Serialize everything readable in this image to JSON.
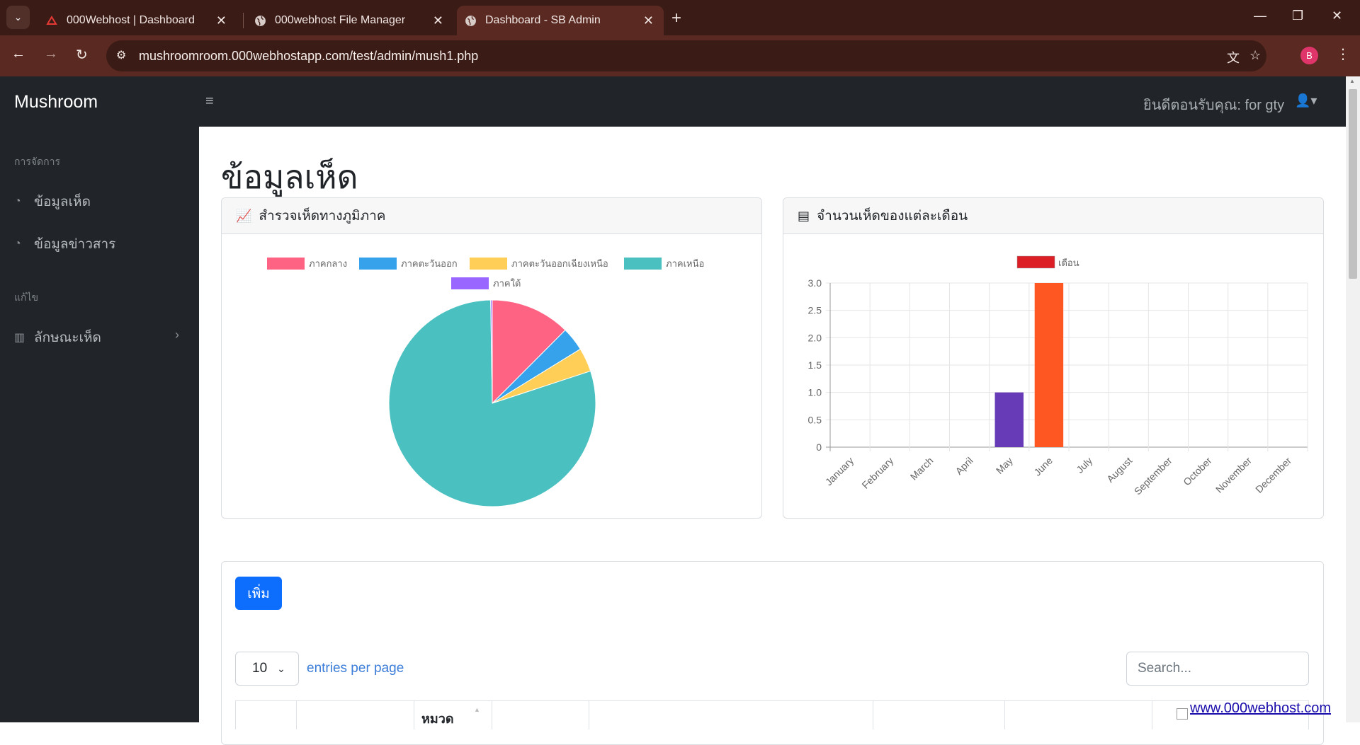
{
  "browser": {
    "tabs": [
      {
        "title": "000Webhost | Dashboard",
        "icon": "webhost-logo-icon"
      },
      {
        "title": "000webhost File Manager",
        "icon": "globe-icon"
      },
      {
        "title": "Dashboard - SB Admin",
        "icon": "globe-icon",
        "active": true
      }
    ],
    "url": "mushroomroom.000webhostapp.com/test/admin/mush1.php",
    "profile_initial": "B"
  },
  "navbar": {
    "brand": "Mushroom",
    "welcome": "ยินดีตอนรับคุณ: for gty"
  },
  "sidebar": {
    "sections": [
      {
        "heading": "การจัดการ",
        "items": [
          {
            "label": "ข้อมูลเห็ด",
            "icon": "dashboard-icon"
          },
          {
            "label": "ข้อมูลข่าวสาร",
            "icon": "dashboard-icon"
          }
        ]
      },
      {
        "heading": "แก้ไข",
        "items": [
          {
            "label": "ลักษณะเห็ด",
            "icon": "columns-icon"
          }
        ]
      }
    ]
  },
  "main": {
    "title": "ข้อมูลเห็ด",
    "pie_card_title": "สำรวจเห็ดทางภูมิภาค",
    "bar_card_title": "จำนวนเห็ดของแต่ละเดือน",
    "add_button": "เพิ่ม",
    "entries_value": "10",
    "entries_label": "entries per page",
    "search_placeholder": "Search...",
    "table_header_visible": "หมวด"
  },
  "footer_link": "www.000webhost.com",
  "chart_data": [
    {
      "type": "pie",
      "categories": [
        "ภาคกลาง",
        "ภาคตะวันออก",
        "ภาคตะวันออกเฉียงเหนือ",
        "ภาคเหนือ",
        "ภาคใต้"
      ],
      "values": [
        5,
        1.5,
        1.5,
        32,
        0.1
      ],
      "colors": [
        "#ff6384",
        "#36a2eb",
        "#ffce56",
        "#4bc0c0",
        "#9966ff"
      ],
      "legend": "top"
    },
    {
      "type": "bar",
      "categories": [
        "January",
        "February",
        "March",
        "April",
        "May",
        "June",
        "July",
        "August",
        "September",
        "October",
        "November",
        "December"
      ],
      "series": [
        {
          "name": "เดือน",
          "values": [
            0,
            0,
            0,
            0,
            1,
            3,
            0,
            0,
            0,
            0,
            0,
            0
          ]
        }
      ],
      "bar_colors": [
        "#c9cbcf",
        "#c9cbcf",
        "#c9cbcf",
        "#c9cbcf",
        "#673ab7",
        "#ff5722",
        "#c9cbcf",
        "#c9cbcf",
        "#c9cbcf",
        "#c9cbcf",
        "#c9cbcf",
        "#c9cbcf"
      ],
      "legend_color": "#dc1f26",
      "yticks": [
        "0",
        "0.5",
        "1.0",
        "1.5",
        "2.0",
        "2.5",
        "3.0"
      ],
      "ylim": [
        0,
        3
      ],
      "grid": true,
      "legend": "top"
    }
  ]
}
